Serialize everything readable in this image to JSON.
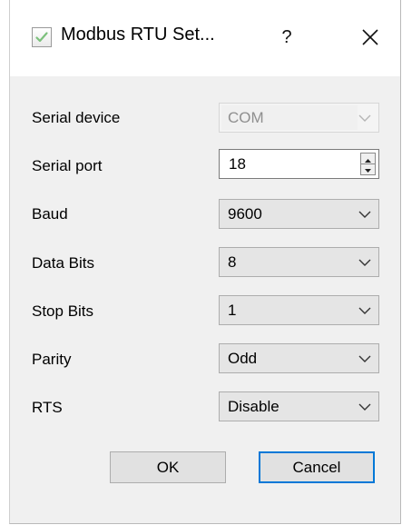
{
  "window": {
    "title": "Modbus RTU Set...",
    "help_label": "?",
    "icon": "checkbox-app-icon"
  },
  "fields": {
    "serial_device": {
      "label": "Serial device",
      "value": "COM",
      "enabled": false
    },
    "serial_port": {
      "label": "Serial port",
      "value": "18"
    },
    "baud": {
      "label": "Baud",
      "value": "9600"
    },
    "data_bits": {
      "label": "Data Bits",
      "value": "8"
    },
    "stop_bits": {
      "label": "Stop Bits",
      "value": "1"
    },
    "parity": {
      "label": "Parity",
      "value": "Odd"
    },
    "rts": {
      "label": "RTS",
      "value": "Disable"
    }
  },
  "buttons": {
    "ok_label": "OK",
    "cancel_label": "Cancel"
  },
  "colors": {
    "focus_border": "#0078d7",
    "check_green": "#5cb85c"
  }
}
